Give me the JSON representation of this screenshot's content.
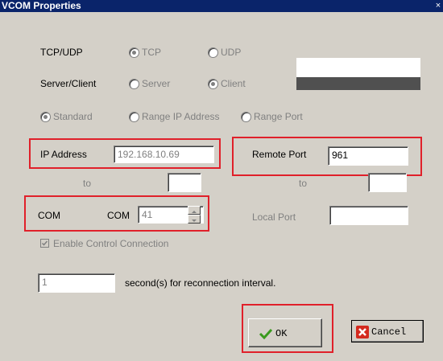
{
  "window": {
    "title": "VCOM Properties",
    "close_glyph": "×"
  },
  "protocol": {
    "label": "TCP/UDP",
    "options": [
      "TCP",
      "UDP"
    ],
    "selected": "TCP"
  },
  "mode": {
    "label": "Server/Client",
    "options": [
      "Server",
      "Client"
    ],
    "selected": "Client"
  },
  "range": {
    "options": [
      "Standard",
      "Range IP Address",
      "Range Port"
    ],
    "selected": "Standard"
  },
  "ip": {
    "label": "IP Address",
    "value": "192.168.10.69",
    "to_label": "to",
    "to_value": ""
  },
  "remote_port": {
    "label": "Remote Port",
    "value": "961",
    "to_label": "to",
    "to_value": ""
  },
  "com": {
    "label": "COM",
    "prefix": "COM",
    "value": "41"
  },
  "local_port": {
    "label": "Local Port",
    "value": ""
  },
  "control": {
    "label": "Enable Control Connection",
    "checked": true
  },
  "reconnect": {
    "value": "1",
    "suffix": "second(s) for reconnection interval."
  },
  "buttons": {
    "ok": "OK",
    "cancel": "Cancel"
  },
  "colors": {
    "titlebar": "#0a246a",
    "dialog": "#d4d0c8",
    "highlight": "#e0202a",
    "ok_check": "#3a9a1e",
    "cancel_x": "#d42a1e"
  }
}
